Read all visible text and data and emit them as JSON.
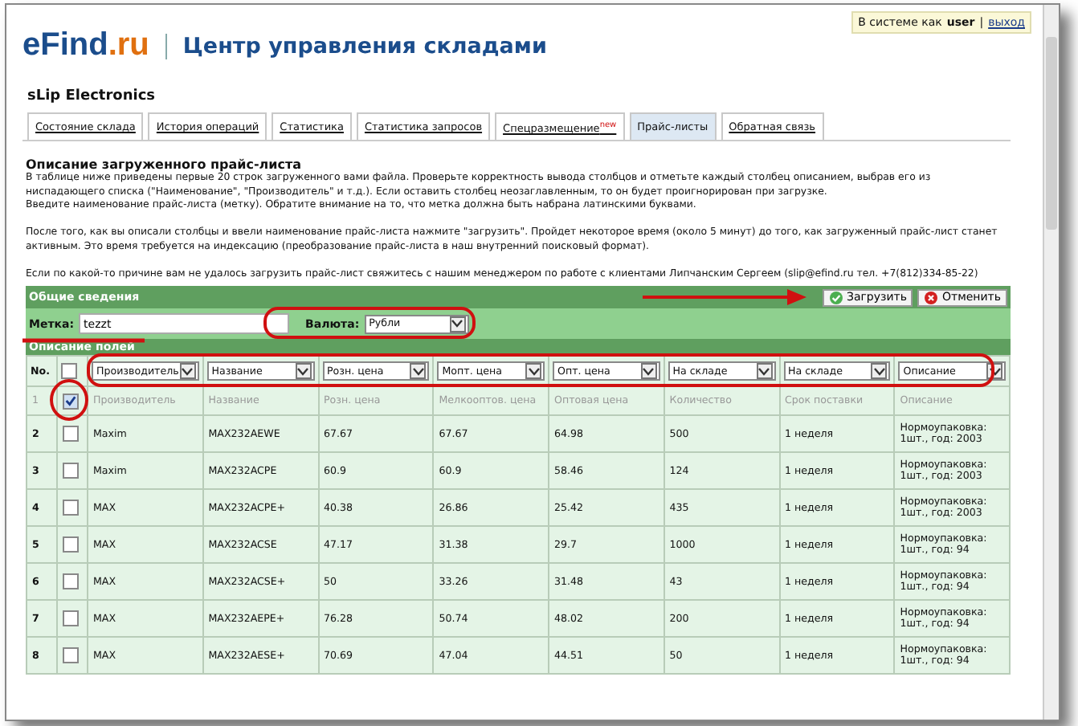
{
  "session": {
    "label": "В системе как",
    "user": "user",
    "separator": "|",
    "logout": "выход"
  },
  "logo": {
    "main": "eFind",
    "tld": ".ru"
  },
  "header_title": "Центр управления складами",
  "company": "sLip Electronics",
  "tabs": [
    {
      "label": "Состояние склада",
      "selected": false
    },
    {
      "label": "История операций",
      "selected": false
    },
    {
      "label": "Статистика",
      "selected": false
    },
    {
      "label": "Статистика запросов",
      "selected": false
    },
    {
      "label": "Спецразмещение$^{new}$",
      "selected": false
    },
    {
      "label": "Прайс-листы",
      "selected": true
    },
    {
      "label": "Обратная связь",
      "selected": false
    }
  ],
  "section_title": "Описание загруженного прайс-листа",
  "paragraphs": [
    "В таблице ниже приведены первые 20 строк загруженного вами файла. Проверьте корректность вывода столбцов и отметьте каждый столбец описанием, выбрав его из ниспадающего списка (\"Наименование\", \"Производитель\" и т.д.). Если оставить столбец неозаглавленным, то он будет проигнорирован при загрузке.",
    "Введите наименование прайс-листа (метку). Обратите внимание на то, что метка должна быть набрана латинскими буквами.",
    "После того, как вы описали столбцы и ввели наименование прайс-листа нажмите \"загрузить\". Пройдет некоторое время (около 5 минут) до того, как загруженный прайс-лист станет активным. Это время требуется на индексацию (преобразование прайс-листа в наш внутренний поисковый формат).",
    "Если по какой-то причине вам не удалось загрузить прайс-лист свяжитесь с нашим менеджером по работе с клиентами Липчанским Сергеем (slip@efind.ru тел. +7(812)334-85-22)"
  ],
  "general": {
    "title": "Общие сведения",
    "buttons": [
      {
        "label": "Загрузить",
        "kind": "ok"
      },
      {
        "label": "Отменить",
        "kind": "cancel"
      }
    ],
    "tag_label": "Метка:",
    "tag_value": "tezzt",
    "currency_label": "Валюта:",
    "currency_value": "Рубли"
  },
  "fields": {
    "title": "Описание полей",
    "no_label": "No.",
    "all_checked": false,
    "selects": [
      "Производитель",
      "Название",
      "Розн. цена",
      "Мопт. цена",
      "Опт. цена",
      "На складе",
      "На складе",
      "Описание"
    ]
  },
  "rows": [
    {
      "kind": "caption",
      "no": "1",
      "checked": true,
      "cells": [
        "Производитель",
        "Название",
        "Розн. цена",
        "Мелкооптов. цена",
        "Оптовая цена",
        "Количество",
        "Срок поставки",
        "Описание"
      ]
    },
    {
      "kind": "data",
      "no": "2",
      "checked": false,
      "cells": [
        "Maxim",
        "MAX232AEWE",
        "67.67",
        "67.67",
        "64.98",
        "500",
        "1 неделя",
        "Нормоупаковка: 1шт., год: 2003"
      ]
    },
    {
      "kind": "data",
      "no": "3",
      "checked": false,
      "cells": [
        "Maxim",
        "MAX232ACPE",
        "60.9",
        "60.9",
        "58.46",
        "124",
        "1 неделя",
        "Нормоупаковка: 1шт., год: 2003"
      ]
    },
    {
      "kind": "data",
      "no": "4",
      "checked": false,
      "cells": [
        "MAX",
        "MAX232ACPE+",
        "40.38",
        "26.86",
        "25.42",
        "435",
        "1 неделя",
        "Нормоупаковка: 1шт., год: 2003"
      ]
    },
    {
      "kind": "data",
      "no": "5",
      "checked": false,
      "cells": [
        "MAX",
        "MAX232ACSE",
        "47.17",
        "31.38",
        "29.7",
        "1000",
        "1 неделя",
        "Нормоупаковка: 1шт., год: 94"
      ]
    },
    {
      "kind": "data",
      "no": "6",
      "checked": false,
      "cells": [
        "MAX",
        "MAX232ACSE+",
        "50",
        "33.26",
        "31.48",
        "43",
        "1 неделя",
        "Нормоупаковка: 1шт., год: 94"
      ]
    },
    {
      "kind": "data",
      "no": "7",
      "checked": false,
      "cells": [
        "MAX",
        "MAX232AEPE+",
        "76.28",
        "50.74",
        "48.02",
        "200",
        "1 неделя",
        "Нормоупаковка: 1шт., год: 94"
      ]
    },
    {
      "kind": "data",
      "no": "8",
      "checked": false,
      "cells": [
        "MAX",
        "MAX232AESE+",
        "70.69",
        "47.04",
        "44.51",
        "50",
        "1 неделя",
        "Нормоупаковка: 1шт., год: 94"
      ]
    }
  ]
}
